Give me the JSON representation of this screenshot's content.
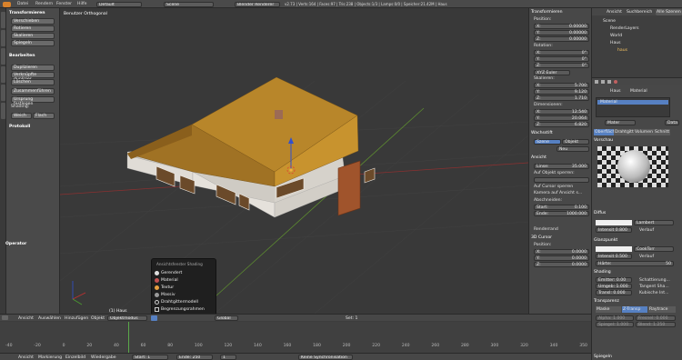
{
  "topbar": {
    "menus": [
      "Datei",
      "Rendern",
      "Fenster",
      "Hilfe"
    ],
    "layout": "Default",
    "scene": "Scene",
    "renderer": "Blender Renderer",
    "stats": "v2.73 | Verts:164 | Faces:97 | Tris:238 | Objects:1/3 | Lamps:0/0 | Speicher:21.42M | Haus"
  },
  "tools": {
    "transform_title": "Transformieren",
    "transform_buttons": [
      "Verschieben",
      "Rotieren",
      "Skalieren",
      "Spiegeln"
    ],
    "edit_title": "Bearbeiten",
    "edit_buttons": [
      "Duplizieren",
      "Verknüpfte duplizier...",
      "Löschen",
      "Zusammenführen"
    ],
    "origin_button": "Ursprung festlegen",
    "shading_label": "Shading:",
    "shading_smooth": "Weich",
    "shading_flat": "Flach",
    "history_title": "Protokoll",
    "operator_title": "Operator"
  },
  "viewport": {
    "view_label": "Benutzer Orthogonal",
    "object_label": "(1) Haus"
  },
  "shading_popup": {
    "title": "Ansichtsfenster Shading",
    "items": [
      "Gerendert",
      "Material",
      "Textur",
      "Massiv",
      "Drahtgittermodell",
      "Begrenzungsrahmen"
    ]
  },
  "npanel": {
    "transform_title": "Transformieren",
    "location_label": "Position:",
    "location": [
      {
        "axis": "X:",
        "value": "0.00000"
      },
      {
        "axis": "Y:",
        "value": "0.00000"
      },
      {
        "axis": "Z:",
        "value": "0.00000"
      }
    ],
    "rotation_label": "Rotation:",
    "rotation": [
      {
        "axis": "X:",
        "value": "0°"
      },
      {
        "axis": "Y:",
        "value": "0°"
      },
      {
        "axis": "Z:",
        "value": "0°"
      }
    ],
    "rotation_mode": "XYZ Euler",
    "scale_label": "Skalieren:",
    "scale": [
      {
        "axis": "X:",
        "value": "5.700"
      },
      {
        "axis": "Y:",
        "value": "9.120"
      },
      {
        "axis": "Z:",
        "value": "1.710"
      }
    ],
    "dimensions_label": "Dimensionen:",
    "dimensions": [
      {
        "axis": "X:",
        "value": "12.540"
      },
      {
        "axis": "Y:",
        "value": "20.064"
      },
      {
        "axis": "Z:",
        "value": "6.820"
      }
    ],
    "grease_title": "Wachsstift",
    "grease_scene": "Szene",
    "grease_object": "Objekt",
    "grease_new": "Neu",
    "view_title": "Ansicht",
    "lens_label": "Linse:",
    "lens_value": "35.000",
    "lock_label": "Auf Objekt sperren:",
    "cursor_lock": "Auf Cursor sperren",
    "camera_lock": "Kamera auf Ansicht s...",
    "clip_label": "Abschneiden:",
    "clip_start_label": "Start:",
    "clip_start": "0.100",
    "clip_end_label": "Ende:",
    "clip_end": "1000.000",
    "render_border": "Renderrand",
    "cursor_title": "3D Cursor",
    "cursor_location_label": "Position:",
    "cursor_location": [
      {
        "axis": "X:",
        "value": "0.0000"
      },
      {
        "axis": "Y:",
        "value": "0.0000"
      },
      {
        "axis": "Z:",
        "value": "0.0000"
      }
    ]
  },
  "outliner": {
    "tabs": [
      "Ansicht",
      "Suchbereich",
      "Alle Szenen"
    ],
    "items": [
      "Scene",
      "RenderLayers",
      "World",
      "Haus",
      "haus"
    ]
  },
  "properties": {
    "breadcrumb": [
      "Haus",
      "Material"
    ],
    "slot": "Material",
    "material_name": "Mater",
    "data_button": "Data",
    "tabs": [
      "Oberfläche",
      "Drahtgitt",
      "Volumen",
      "Schnitt"
    ],
    "preview_title": "Vorschau",
    "diffuse_title": "Diffus",
    "diffuse_shader": "Lambert",
    "diffuse_intensity": "Intensit 0.800",
    "ramp": "Verlauf",
    "specular_title": "Glanzpunkt",
    "specular_shader": "CookTorr",
    "specular_intensity": "Intensit 0.500",
    "hardness": "Härte:",
    "hardness_value": "50",
    "shading_title": "Shading",
    "emit": "Emitter: 0.00",
    "ambient": "Umgeb: 1.000",
    "translucency": "Transl: 0.000",
    "shadeless": "Schattierung...",
    "tangent": "Tangent Sha...",
    "cubic": "Kubische Int...",
    "transparency_title": "Transparenz",
    "trans_modes": [
      "Maske",
      "Z-Transp",
      "Raytrace"
    ],
    "alpha": "Alpha: 1.000",
    "fresnel": "Fresnel: 0.000",
    "specular_val": "Spiegel: 1.000",
    "blend": "Blend: 1.250",
    "mirror_title": "Spiegeln"
  },
  "viewheader": {
    "menus": [
      "Ansicht",
      "Auswählen",
      "Hinzufügen",
      "Objekt"
    ],
    "mode": "Objektmodus",
    "pivot": "Global",
    "layers_label": "Set: 1"
  },
  "timeline": {
    "ticks": [
      "-40",
      "-20",
      "0",
      "20",
      "40",
      "60",
      "80",
      "100",
      "120",
      "140",
      "160",
      "180",
      "200",
      "220",
      "240",
      "260",
      "280",
      "300",
      "320",
      "340",
      "350"
    ],
    "menus": [
      "Ansicht",
      "Markierung",
      "Einzelbild",
      "Wiedergabe"
    ],
    "start_label": "Start:",
    "start": "1",
    "end_label": "Ende:",
    "end": "250",
    "sync": "Keine Synchronisation",
    "current": "1"
  },
  "colors": {
    "accent": "#5680c2",
    "roof": "#b8862a",
    "wall": "#d9d5cf",
    "door": "#a0542c"
  }
}
